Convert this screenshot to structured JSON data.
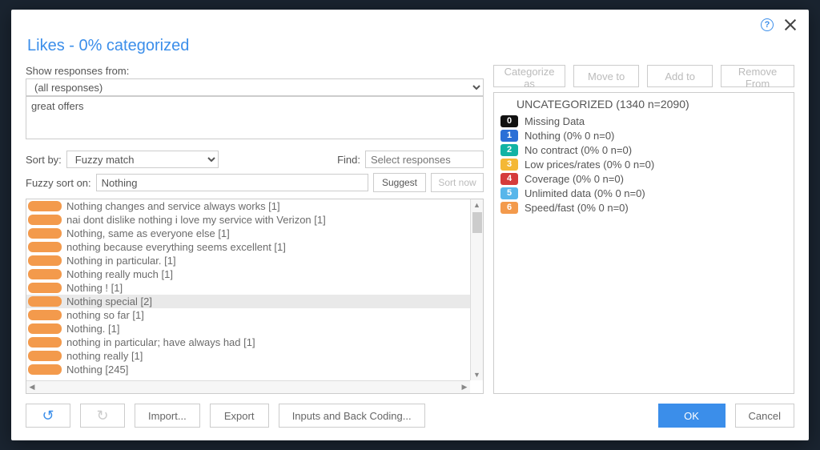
{
  "title": "Likes - 0% categorized",
  "help_glyph": "?",
  "left": {
    "show_label": "Show responses from:",
    "show_value": "(all responses)",
    "current_response": "great offers",
    "sort_label": "Sort by:",
    "sort_value": "Fuzzy match",
    "find_label": "Find:",
    "find_placeholder": "Select responses",
    "fuzzy_label": "Fuzzy sort on:",
    "fuzzy_value": "Nothing",
    "suggest": "Suggest",
    "sort_now": "Sort now",
    "responses": [
      {
        "text": "Nothing changes and service always works [1]",
        "selected": false
      },
      {
        "text": "nai dont dislike nothing i love my service with Verizon [1]",
        "selected": false
      },
      {
        "text": "Nothing, same as everyone else [1]",
        "selected": false
      },
      {
        "text": "nothing because everything seems excellent [1]",
        "selected": false
      },
      {
        "text": "Nothing in particular. [1]",
        "selected": false
      },
      {
        "text": "Nothing really much [1]",
        "selected": false
      },
      {
        "text": "Nothing ! [1]",
        "selected": false
      },
      {
        "text": "Nothing special [2]",
        "selected": true
      },
      {
        "text": "nothing so far [1]",
        "selected": false
      },
      {
        "text": "Nothing. [1]",
        "selected": false
      },
      {
        "text": "nothing in particular; have always had [1]",
        "selected": false
      },
      {
        "text": "nothing really [1]",
        "selected": false
      },
      {
        "text": "Nothing [245]",
        "selected": false
      }
    ]
  },
  "right": {
    "actions": {
      "categorize": "Categorize as",
      "move": "Move to",
      "add": "Add to",
      "remove": "Remove From"
    },
    "uncategorized_header": "UNCATEGORIZED (1340 n=2090)",
    "categories": [
      {
        "num": "0",
        "color": "#111111",
        "label": "Missing Data"
      },
      {
        "num": "1",
        "color": "#2b6fd6",
        "label": "Nothing (0% 0 n=0)"
      },
      {
        "num": "2",
        "color": "#12b3a4",
        "label": "No contract (0% 0 n=0)"
      },
      {
        "num": "3",
        "color": "#f4b836",
        "label": "Low prices/rates (0% 0 n=0)"
      },
      {
        "num": "4",
        "color": "#d53b3b",
        "label": "Coverage (0% 0 n=0)"
      },
      {
        "num": "5",
        "color": "#58b6ea",
        "label": "Unlimited data (0% 0 n=0)"
      },
      {
        "num": "6",
        "color": "#f39a4c",
        "label": "Speed/fast (0% 0 n=0)"
      }
    ]
  },
  "footer": {
    "import": "Import...",
    "export": "Export",
    "inputs": "Inputs and Back Coding...",
    "ok": "OK",
    "cancel": "Cancel"
  }
}
